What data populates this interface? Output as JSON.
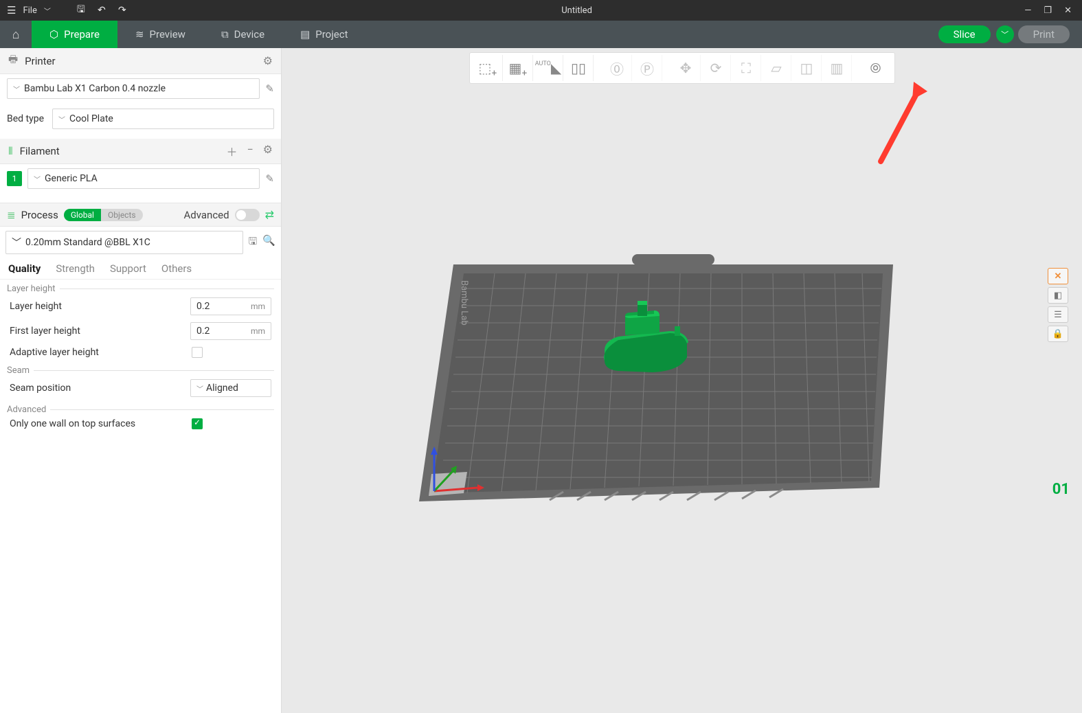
{
  "titlebar": {
    "file_label": "File",
    "title": "Untitled"
  },
  "tabs": {
    "home": "⌂",
    "prepare": "Prepare",
    "preview": "Preview",
    "device": "Device",
    "project": "Project",
    "slice": "Slice",
    "print": "Print"
  },
  "printer": {
    "section": "Printer",
    "selected": "Bambu Lab X1 Carbon 0.4 nozzle",
    "bed_type_label": "Bed type",
    "bed_type_value": "Cool Plate"
  },
  "filament": {
    "section": "Filament",
    "items": [
      {
        "index": "1",
        "name": "Generic PLA"
      }
    ]
  },
  "process": {
    "section": "Process",
    "pill_global": "Global",
    "pill_objects": "Objects",
    "advanced_label": "Advanced",
    "preset": "0.20mm Standard @BBL X1C",
    "tabs": {
      "quality": "Quality",
      "strength": "Strength",
      "support": "Support",
      "others": "Others"
    },
    "groups": {
      "layer_height": {
        "title": "Layer height",
        "layer_height_label": "Layer height",
        "layer_height_value": "0.2",
        "layer_height_unit": "mm",
        "first_layer_label": "First layer height",
        "first_layer_value": "0.2",
        "first_layer_unit": "mm",
        "adaptive_label": "Adaptive layer height"
      },
      "seam": {
        "title": "Seam",
        "position_label": "Seam position",
        "position_value": "Aligned"
      },
      "advanced": {
        "title": "Advanced",
        "only_one_wall_label": "Only one wall on top surfaces"
      }
    }
  },
  "viewport": {
    "plate_number": "01",
    "plate_brand": "Bambu Lab"
  }
}
